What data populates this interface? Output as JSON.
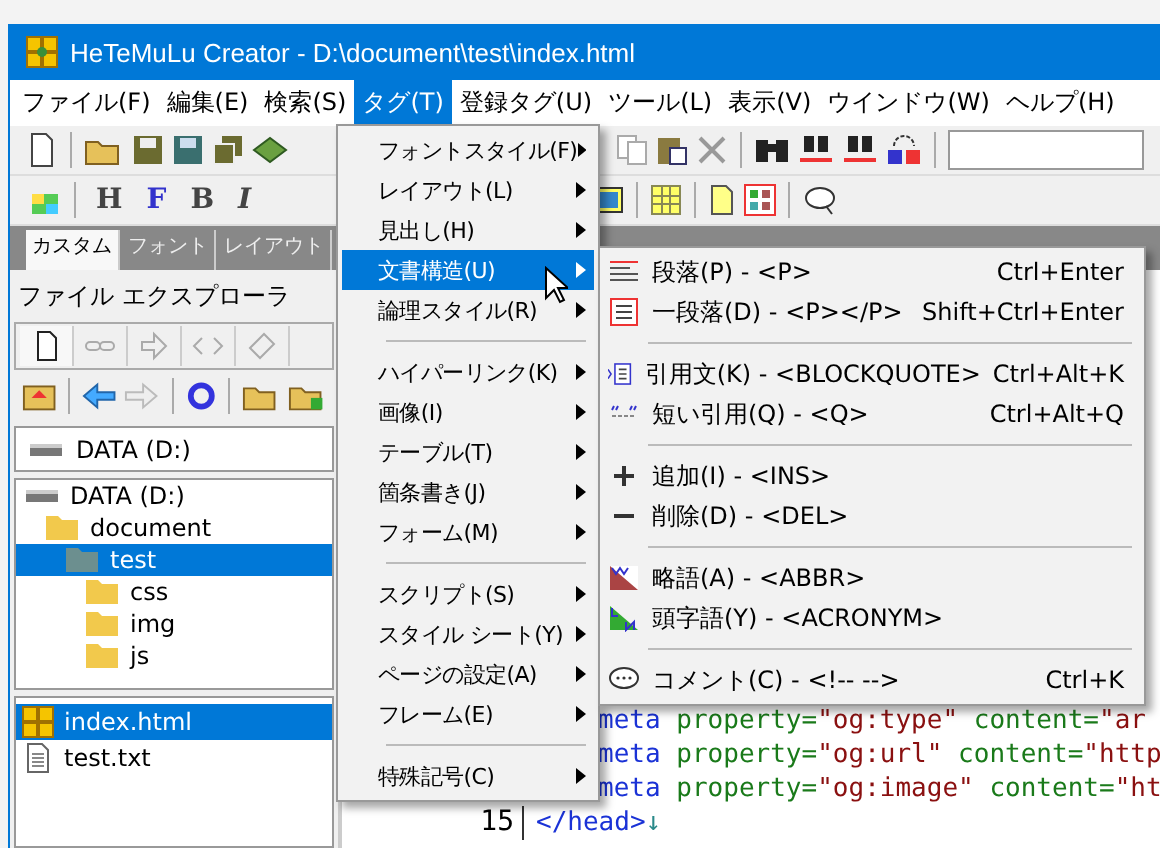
{
  "window": {
    "title": "HeTeMuLu Creator - D:\\document\\test\\index.html"
  },
  "menu_bar": [
    {
      "label": "ファイル(F)",
      "selected": false
    },
    {
      "label": "編集(E)",
      "selected": false
    },
    {
      "label": "検索(S)",
      "selected": false
    },
    {
      "label": "タグ(T)",
      "selected": true
    },
    {
      "label": "登録タグ(U)",
      "selected": false
    },
    {
      "label": "ツール(L)",
      "selected": false
    },
    {
      "label": "表示(V)",
      "selected": false
    },
    {
      "label": "ウインドウ(W)",
      "selected": false
    },
    {
      "label": "ヘルプ(H)",
      "selected": false
    }
  ],
  "format_buttons": [
    {
      "label": "H",
      "kind": "heading"
    },
    {
      "label": "F",
      "kind": "font"
    },
    {
      "label": "B",
      "kind": "bold"
    },
    {
      "label": "I",
      "kind": "italic"
    }
  ],
  "palette_tabs": [
    {
      "label": "カスタム",
      "selected": true
    },
    {
      "label": "フォント",
      "selected": false
    },
    {
      "label": "レイアウト",
      "selected": false
    }
  ],
  "explorer": {
    "title": "ファイル エクスプローラ",
    "drive": "DATA (D:)",
    "tree": [
      {
        "label": "DATA (D:)",
        "kind": "drive",
        "selected": false,
        "children": [
          {
            "label": "document",
            "kind": "folder",
            "selected": false,
            "children": [
              {
                "label": "test",
                "kind": "folder",
                "selected": true,
                "children": [
                  {
                    "label": "css",
                    "kind": "folder",
                    "selected": false
                  },
                  {
                    "label": "img",
                    "kind": "folder",
                    "selected": false
                  },
                  {
                    "label": "js",
                    "kind": "folder",
                    "selected": false
                  }
                ]
              }
            ]
          }
        ]
      }
    ],
    "files": [
      {
        "label": "index.html",
        "kind": "html",
        "selected": true
      },
      {
        "label": "test.txt",
        "kind": "text",
        "selected": false
      }
    ]
  },
  "editor": {
    "lines": [
      {
        "segments": [
          {
            "text": "meta",
            "kind": "tag"
          },
          {
            "text": " property=",
            "kind": "attr"
          },
          {
            "text": "\"og:type\"",
            "kind": "value"
          },
          {
            "text": " content=",
            "kind": "attr"
          },
          {
            "text": "\"ar",
            "kind": "value"
          }
        ]
      },
      {
        "segments": [
          {
            "text": "meta",
            "kind": "tag"
          },
          {
            "text": " property=",
            "kind": "attr"
          },
          {
            "text": "\"og:url\"",
            "kind": "value"
          },
          {
            "text": " content=",
            "kind": "attr"
          },
          {
            "text": "\"http",
            "kind": "value"
          }
        ]
      },
      {
        "segments": [
          {
            "text": "meta",
            "kind": "tag"
          },
          {
            "text": " property=",
            "kind": "attr"
          },
          {
            "text": "\"og:image\"",
            "kind": "value"
          },
          {
            "text": " content=",
            "kind": "attr"
          },
          {
            "text": "\"ht",
            "kind": "value"
          }
        ]
      },
      {
        "number": "15",
        "segments": [
          {
            "text": "</head>",
            "kind": "tag"
          },
          {
            "text": "↓",
            "kind": "eol"
          }
        ]
      }
    ]
  },
  "tag_menu": [
    {
      "kind": "item",
      "label": "フォントスタイル(F)",
      "selected": false
    },
    {
      "kind": "item",
      "label": "レイアウト(L)",
      "selected": false
    },
    {
      "kind": "item",
      "label": "見出し(H)",
      "selected": false
    },
    {
      "kind": "item",
      "label": "文書構造(U)",
      "selected": true
    },
    {
      "kind": "item",
      "label": "論理スタイル(R)",
      "selected": false
    },
    {
      "kind": "separator"
    },
    {
      "kind": "item",
      "label": "ハイパーリンク(K)",
      "selected": false
    },
    {
      "kind": "item",
      "label": "画像(I)",
      "selected": false
    },
    {
      "kind": "item",
      "label": "テーブル(T)",
      "selected": false
    },
    {
      "kind": "item",
      "label": "箇条書き(J)",
      "selected": false
    },
    {
      "kind": "item",
      "label": "フォーム(M)",
      "selected": false
    },
    {
      "kind": "separator"
    },
    {
      "kind": "item",
      "label": "スクリプト(S)",
      "selected": false
    },
    {
      "kind": "item",
      "label": "スタイル シート(Y)",
      "selected": false
    },
    {
      "kind": "item",
      "label": "ページの設定(A)",
      "selected": false
    },
    {
      "kind": "item",
      "label": "フレーム(E)",
      "selected": false
    },
    {
      "kind": "separator"
    },
    {
      "kind": "item",
      "label": "特殊記号(C)",
      "selected": false
    }
  ],
  "submenu": [
    {
      "kind": "paragraph",
      "label": "段落(P) - <P>",
      "shortcut": "Ctrl+Enter"
    },
    {
      "kind": "block",
      "label": "一段落(D) - <P></P>",
      "shortcut": "Shift+Ctrl+Enter"
    },
    {
      "kind": "separator"
    },
    {
      "kind": "blockquote",
      "label": "引用文(K) - <BLOCKQUOTE>",
      "shortcut": "Ctrl+Alt+K"
    },
    {
      "kind": "quote",
      "label": "短い引用(Q) - <Q>",
      "shortcut": "Ctrl+Alt+Q"
    },
    {
      "kind": "separator"
    },
    {
      "kind": "plus",
      "label": "追加(I) - <INS>"
    },
    {
      "kind": "minus",
      "label": "削除(D) - <DEL>"
    },
    {
      "kind": "separator"
    },
    {
      "kind": "abbr",
      "label": "略語(A) - <ABBR>"
    },
    {
      "kind": "acronym",
      "label": "頭字語(Y) - <ACRONYM>"
    },
    {
      "kind": "separator"
    },
    {
      "kind": "comment",
      "label": "コメント(C) - <!-- -->",
      "shortcut": "Ctrl+K"
    }
  ]
}
